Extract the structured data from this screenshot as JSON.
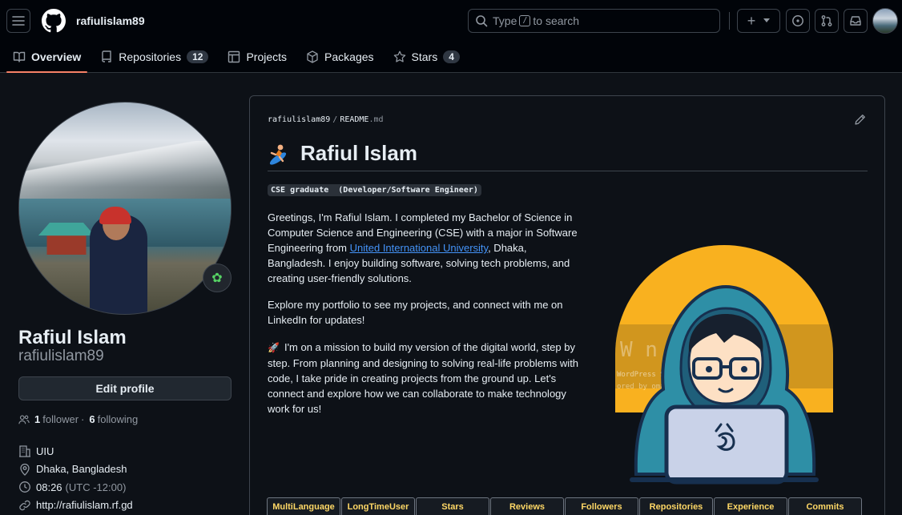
{
  "header": {
    "username": "rafiulislam89",
    "search_prefix": "Type",
    "search_key": "/",
    "search_suffix": "to search",
    "plus_symbol": "+"
  },
  "tabs": [
    {
      "label": "Overview",
      "icon": "book-icon"
    },
    {
      "label": "Repositories",
      "count": "12",
      "icon": "repo-icon"
    },
    {
      "label": "Projects",
      "icon": "table-icon"
    },
    {
      "label": "Packages",
      "icon": "package-icon"
    },
    {
      "label": "Stars",
      "count": "4",
      "icon": "star-icon"
    }
  ],
  "profile": {
    "name": "Rafiul Islam",
    "login": "rafiulislam89",
    "status_emoji": "✿",
    "edit_label": "Edit profile",
    "followers_count": "1",
    "followers_label": "follower",
    "dot": "·",
    "following_count": "6",
    "following_label": "following",
    "organization": "UIU",
    "location": "Dhaka, Bangladesh",
    "local_time": "08:26",
    "timezone": "(UTC -12:00)",
    "website": "http://rafiulislam.rf.gd"
  },
  "readme": {
    "owner": "rafiulislam89",
    "sep": "/",
    "file_name": "README",
    "file_ext": ".md",
    "heading": "Rafiul Islam",
    "code_line": "CSE graduate  (Developer/Software Engineer)",
    "p1_before": "Greetings, I'm Rafiul Islam. I completed my Bachelor of Science in Computer Science and Engineering (CSE) with a major in Software Engineering from ",
    "p1_link": "United International University",
    "p1_after": ", Dhaka, Bangladesh. I enjoy building software, solving tech problems, and creating user-friendly solutions.",
    "p2": "Explore my portfolio to see my projects, and connect with me on LinkedIn for updates!",
    "p3_emoji": "🚀",
    "p3": "I'm on a mission to build my version of the digital world, step by step. From planning and designing to solving real-life problems with code, I take pride in creating projects from the ground up. Let's connect and explore how we can collaborate to make technology work for us!",
    "badges": [
      "MultiLanguage",
      "LongTimeUser",
      "Stars",
      "Reviews",
      "Followers",
      "Repositories",
      "Experience",
      "Commits"
    ]
  },
  "colors": {
    "accent_underline": "#f78166",
    "link": "#4493f8",
    "illustration_sun": "#f9b11f",
    "hoodie": "#2e8fa6"
  }
}
